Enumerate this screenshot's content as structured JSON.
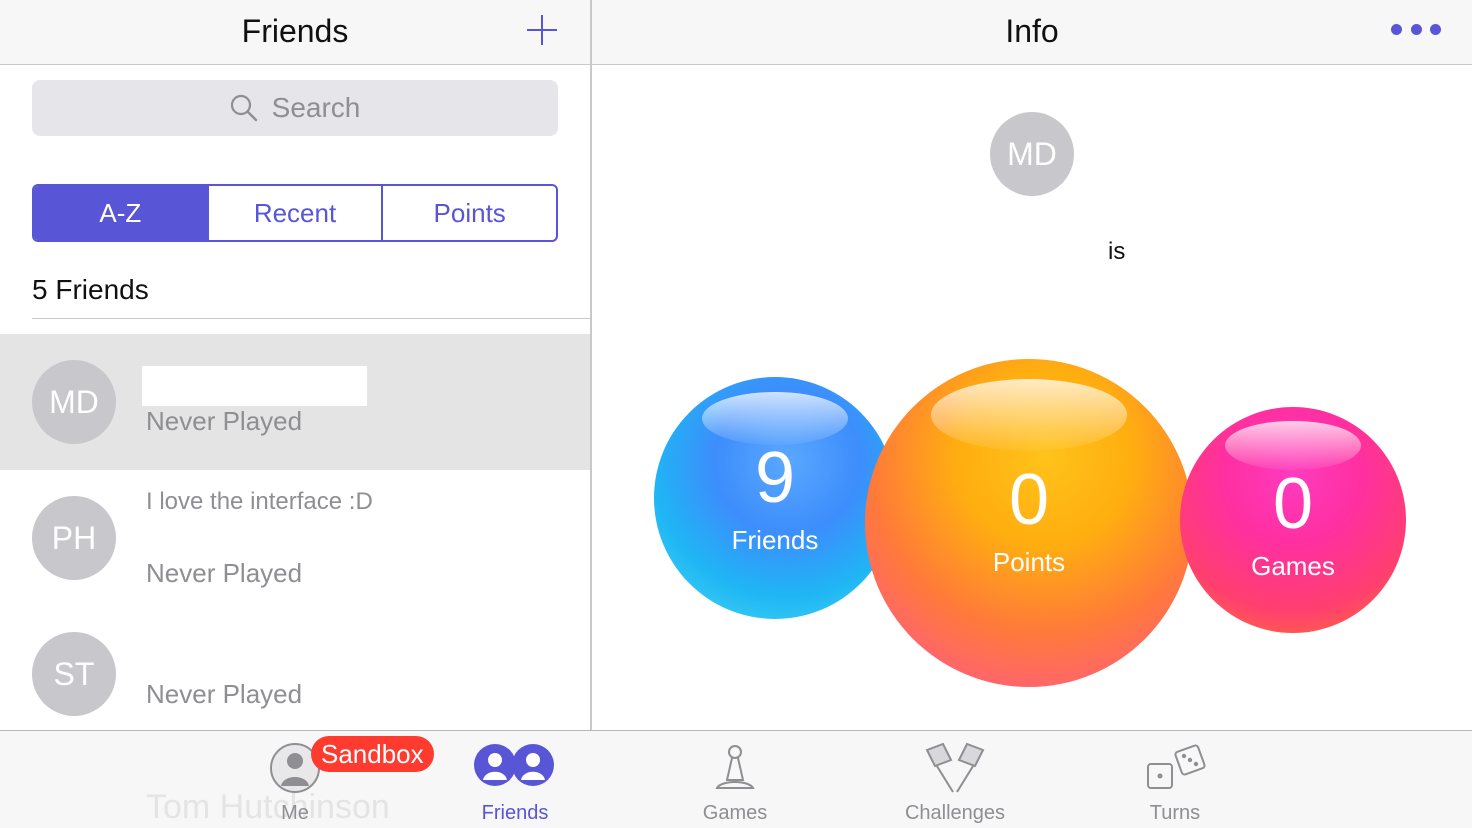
{
  "left_pane": {
    "title": "Friends",
    "add_icon": "plus-icon",
    "search": {
      "placeholder": "Search",
      "icon": "search-icon"
    },
    "segments": [
      {
        "label": "A-Z",
        "active": true
      },
      {
        "label": "Recent",
        "active": false
      },
      {
        "label": "Points",
        "active": false
      }
    ],
    "count_label": "5 Friends",
    "friends": [
      {
        "initials": "MD",
        "message": "",
        "status": "Never Played",
        "selected": true
      },
      {
        "initials": "PH",
        "message": "I love the interface :D",
        "status": "Never Played",
        "selected": false
      },
      {
        "initials": "ST",
        "message": "",
        "status": "Never Played",
        "selected": false
      }
    ]
  },
  "right_pane": {
    "title": "Info",
    "more_icon": "more-icon",
    "avatar_initials": "MD",
    "status_text": "is",
    "bubbles": [
      {
        "value": "9",
        "label": "Friends"
      },
      {
        "value": "0",
        "label": "Points"
      },
      {
        "value": "0",
        "label": "Games"
      }
    ]
  },
  "tab_bar": {
    "sandbox_badge": "Sandbox",
    "player_name": "Tom Hutchinson",
    "tabs": [
      {
        "label": "Me",
        "icon": "person-icon",
        "active": false
      },
      {
        "label": "Friends",
        "icon": "friends-icon",
        "active": true
      },
      {
        "label": "Games",
        "icon": "pawn-icon",
        "active": false
      },
      {
        "label": "Challenges",
        "icon": "flags-icon",
        "active": false
      },
      {
        "label": "Turns",
        "icon": "dice-icon",
        "active": false
      }
    ]
  },
  "colors": {
    "accent": "#5856d6",
    "badge": "#ff3b30",
    "avatar": "#c7c7cc"
  }
}
